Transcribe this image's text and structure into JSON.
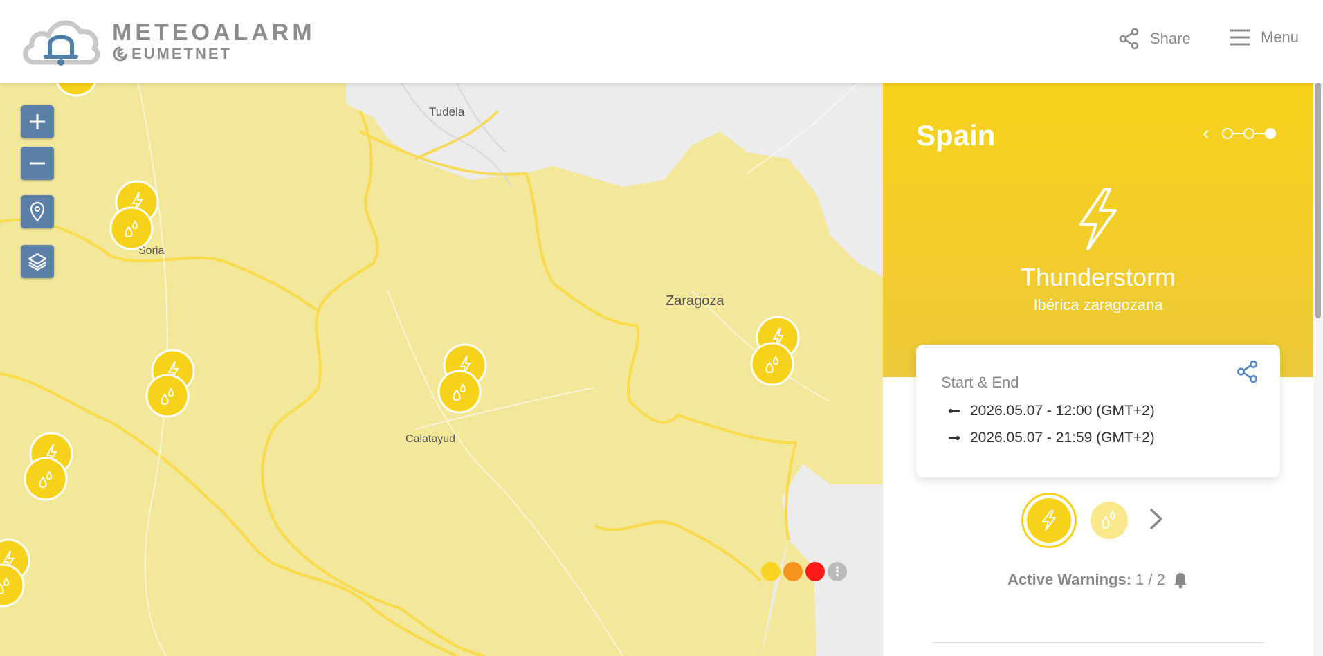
{
  "header": {
    "logo_title": "METEOALARM",
    "logo_sub": "EUMETNET",
    "share_label": "Share",
    "menu_label": "Menu"
  },
  "map": {
    "labels": {
      "tudela": "Tudela",
      "soria": "Soria",
      "zaragoza": "Zaragoza",
      "calatayud": "Calatayud"
    },
    "controls": [
      "zoom-in",
      "zoom-out",
      "locate",
      "layers"
    ],
    "legend_colors": [
      "#f9d423",
      "#f7931e",
      "#ff1a1a"
    ],
    "warning_color": "#f3e79a",
    "border_color": "#f8d940"
  },
  "panel": {
    "country": "Spain",
    "warning_title": "Thunderstorm",
    "warning_region": "Ibérica zaragozana",
    "start_end_label": "Start & End",
    "start": "2026.05.07 - 12:00 (GMT+2)",
    "end": "2026.05.07 - 21:59 (GMT+2)",
    "active_label": "Active Warnings:",
    "active_count": "1 / 2",
    "accent": "#f7d21a"
  }
}
